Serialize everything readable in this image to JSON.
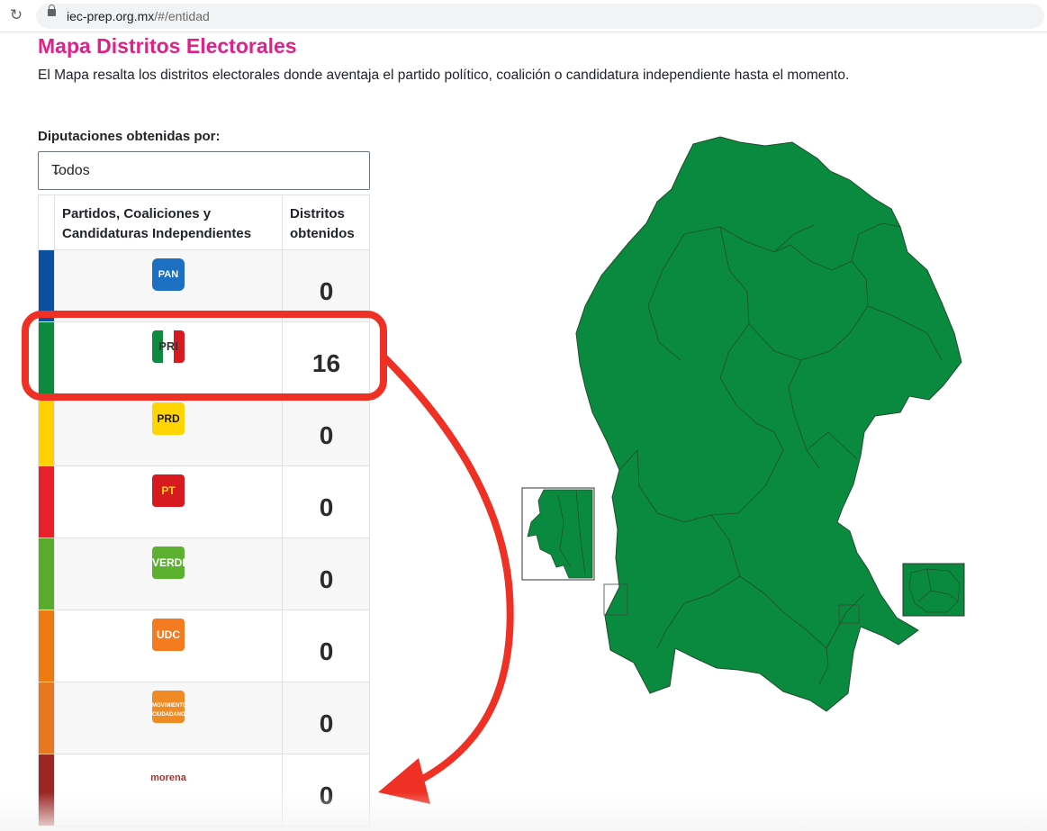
{
  "browser": {
    "url_domain": "iec-prep.org.mx",
    "url_path": "/#/entidad"
  },
  "header": {
    "title": "Mapa Distritos Electorales",
    "description": "El Mapa resalta los distritos electorales donde aventaja el partido político, coalición o candidatura independiente hasta el momento."
  },
  "filter": {
    "label": "Diputaciones obtenidas por:",
    "selected": "Todos"
  },
  "table": {
    "col_party_line1": "Partidos, Coaliciones y",
    "col_party_line2": "Candidaturas Independientes",
    "col_districts_line1": "Distritos",
    "col_districts_line2": "obtenidos",
    "rows": [
      {
        "party": "PAN",
        "color": "#0b4fa0",
        "logo_bg": "#1d6fc2",
        "logo_fg": "#ffffff",
        "districts": "0"
      },
      {
        "party": "PRI",
        "color": "#0c8a3e",
        "logo_bg": "#ffffff",
        "logo_fg": "#333333",
        "districts": "16"
      },
      {
        "party": "PRD",
        "color": "#ffd100",
        "logo_bg": "#ffd400",
        "logo_fg": "#1a1a1a",
        "districts": "0"
      },
      {
        "party": "PT",
        "color": "#e8202a",
        "logo_bg": "#d71920",
        "logo_fg": "#ffde00",
        "districts": "0"
      },
      {
        "party": "VERDE",
        "color": "#5aab2c",
        "logo_bg": "#5cb130",
        "logo_fg": "#ffffff",
        "districts": "0"
      },
      {
        "party": "UDC",
        "color": "#f07a12",
        "logo_bg": "#f47b20",
        "logo_fg": "#ffffff",
        "districts": "0"
      },
      {
        "party": "MOVIMIENTO CIUDADANO",
        "color": "#e8771e",
        "logo_bg": "#f08a24",
        "logo_fg": "#ffffff",
        "districts": "0"
      },
      {
        "party": "morena",
        "color": "#9c2622",
        "logo_bg": "transparent",
        "logo_fg": "#a8322c",
        "districts": "0"
      }
    ]
  },
  "map": {
    "fill_color": "#0a8a3e",
    "highlight_color": "#ee3124"
  }
}
